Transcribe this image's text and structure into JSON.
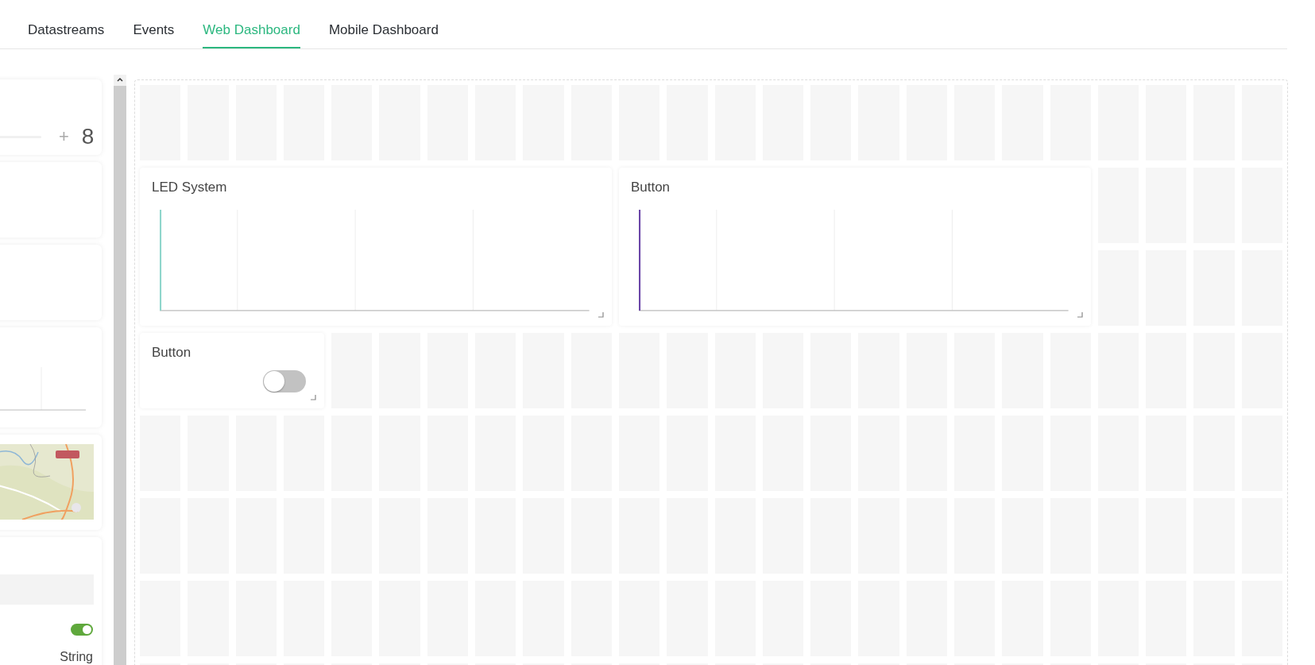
{
  "tabs": [
    {
      "label": "Datastreams",
      "selected": false
    },
    {
      "label": "Events",
      "selected": false
    },
    {
      "label": "Web Dashboard",
      "selected": true
    },
    {
      "label": "Mobile Dashboard",
      "selected": false
    }
  ],
  "widget_library": [
    {
      "kind": "slider",
      "plus": "+",
      "value": "8"
    },
    {
      "kind": "blank"
    },
    {
      "kind": "blank"
    },
    {
      "kind": "chart"
    },
    {
      "kind": "map"
    },
    {
      "kind": "table",
      "on": true,
      "type_label": "String"
    }
  ],
  "dashboard": {
    "widgets": [
      {
        "kind": "chart",
        "title": "LED System",
        "color": "#8fd6cc"
      },
      {
        "kind": "chart",
        "title": "Button",
        "color": "#6b46a8"
      },
      {
        "kind": "switch",
        "title": "Button",
        "on": false
      }
    ]
  }
}
